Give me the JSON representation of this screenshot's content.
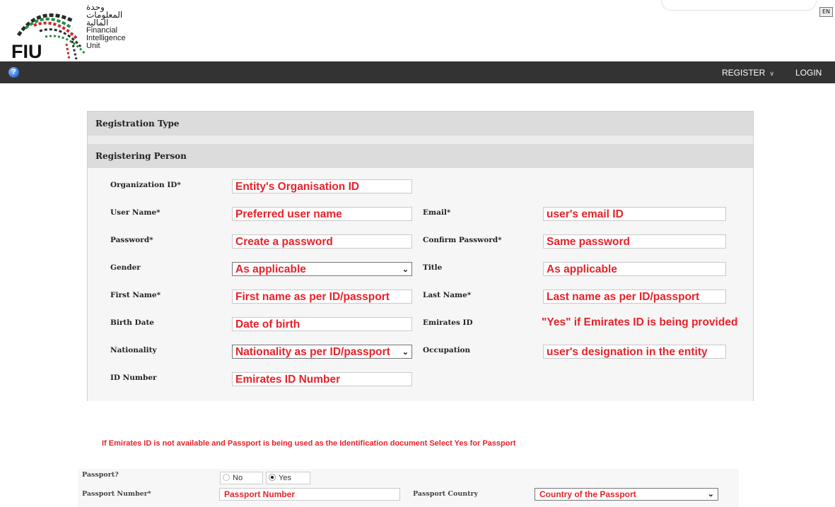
{
  "header": {
    "logo_letters": "FIU",
    "logo_ar_1": "وحدة",
    "logo_ar_2": "المعلومات",
    "logo_ar_3": "المالية",
    "logo_en_1": "Financial",
    "logo_en_2": "Intelligence",
    "logo_en_3": "Unit",
    "lang_button": "EN"
  },
  "nav": {
    "help_icon": "question-circle-icon",
    "register": "REGISTER",
    "login": "LOGIN"
  },
  "sections": {
    "registration_type": "Registration Type",
    "registering_person": "Registering Person"
  },
  "fields": {
    "org_id": {
      "label": "Organization ID*",
      "value": "Entity's Organisation ID"
    },
    "user_name": {
      "label": "User Name*",
      "value": "Preferred user name"
    },
    "email": {
      "label": "Email*",
      "value": "user's email ID"
    },
    "password": {
      "label": "Password*",
      "value": "Create a password"
    },
    "confirm_password": {
      "label": "Confirm Password*",
      "value": "Same password"
    },
    "gender": {
      "label": "Gender",
      "value": "As applicable"
    },
    "title": {
      "label": "Title",
      "value": "As applicable"
    },
    "first_name": {
      "label": "First Name*",
      "value": "First name as per ID/passport"
    },
    "last_name": {
      "label": "Last Name*",
      "value": "Last name as per ID/passport"
    },
    "birth_date": {
      "label": "Birth Date",
      "value": "Date of birth"
    },
    "emirates_id": {
      "label": "Emirates ID",
      "value": "\"Yes\" if Emirates ID is being provided"
    },
    "nationality": {
      "label": "Nationality",
      "value": "Nationality as per ID/passport"
    },
    "occupation": {
      "label": "Occupation",
      "value": "user's designation in the entity"
    },
    "id_number": {
      "label": "ID Number",
      "value": "Emirates ID Number"
    }
  },
  "hint": "If Emirates ID is not available and Passport is being used as the Identification document Select Yes for Passport",
  "passport": {
    "question_label": "Passport?",
    "option_no": "No",
    "option_yes": "Yes",
    "selected": "Yes",
    "number_label": "Passport Number*",
    "number_value": "Passport Number",
    "country_label": "Passport Country",
    "country_value": "Country of the Passport"
  },
  "colors": {
    "nav_bg": "#333333",
    "annotation_red": "#e8222a",
    "section_header_bg": "#dcdcdc"
  }
}
